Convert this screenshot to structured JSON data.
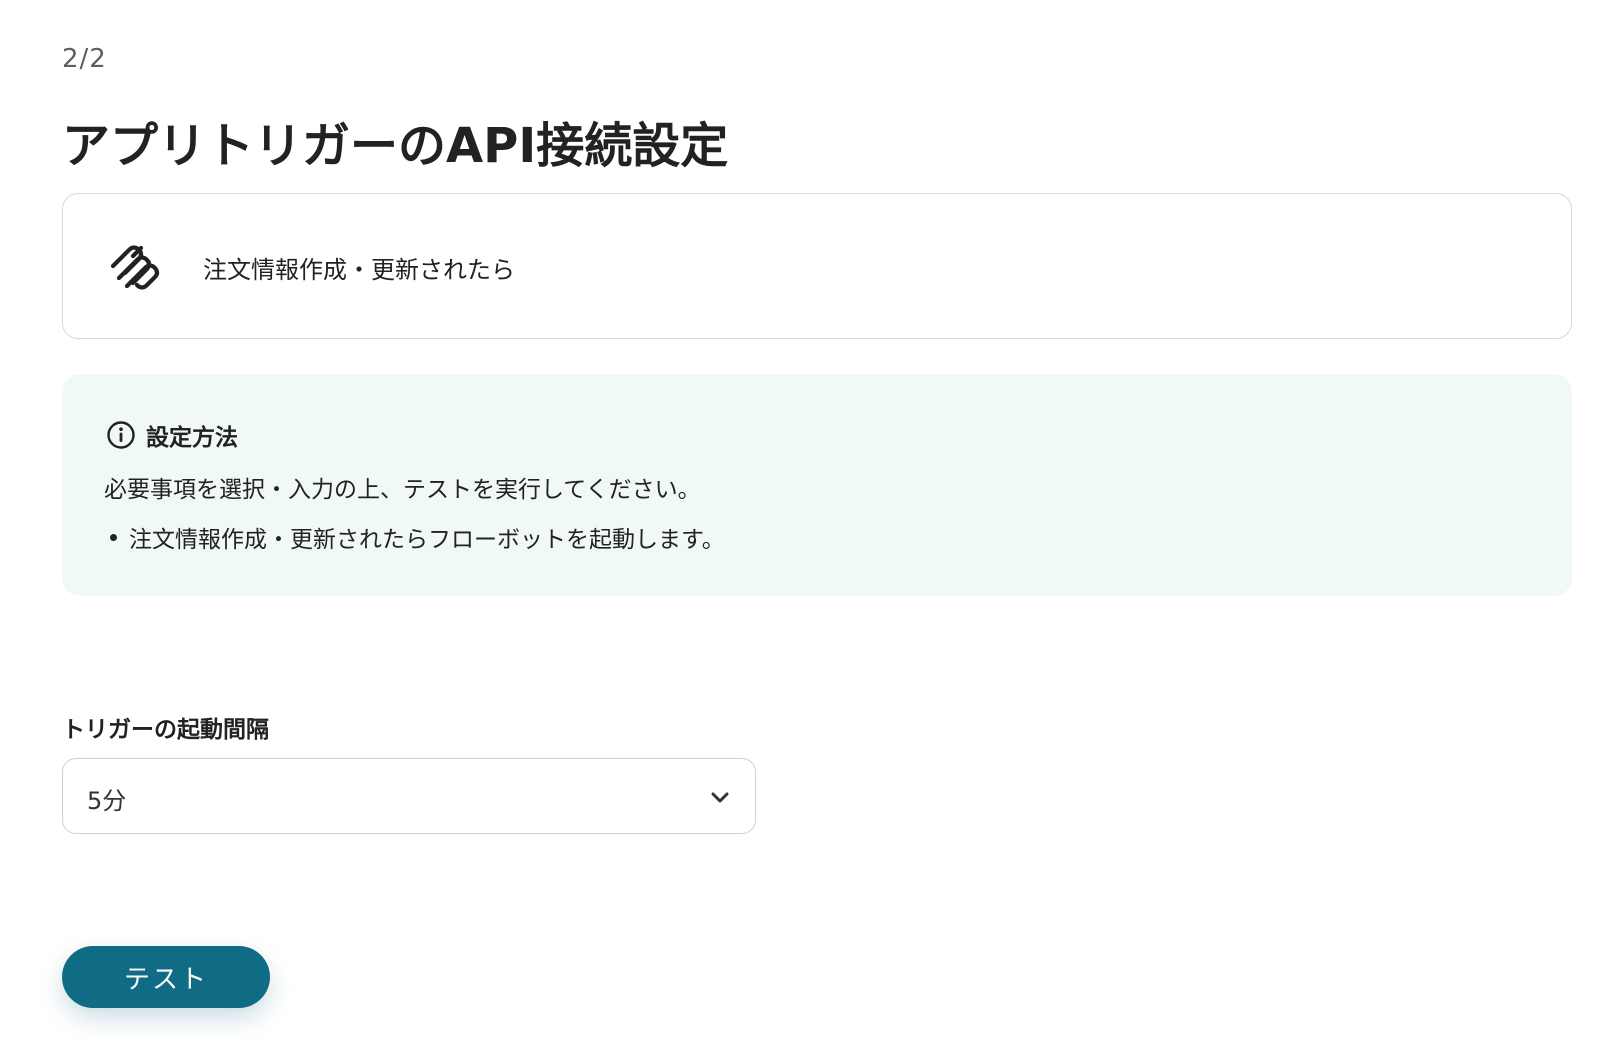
{
  "header": {
    "step": "2/2",
    "title": "アプリトリガーのAPI接続設定"
  },
  "trigger": {
    "app_icon": "squarespace-logo-icon",
    "name": "注文情報作成・更新されたら"
  },
  "info": {
    "icon": "info-circle-icon",
    "title": "設定方法",
    "text": "必要事項を選択・入力の上、テストを実行してください。",
    "bullets": [
      "注文情報作成・更新されたらフローボットを起動します。"
    ]
  },
  "interval": {
    "label": "トリガーの起動間隔",
    "value": "5分",
    "icon": "chevron-down-icon"
  },
  "actions": {
    "test_label": "テスト"
  },
  "colors": {
    "primary_button": "#106b85",
    "info_background": "#f1f9f8",
    "border": "#d9d9d9",
    "text": "#222222"
  }
}
